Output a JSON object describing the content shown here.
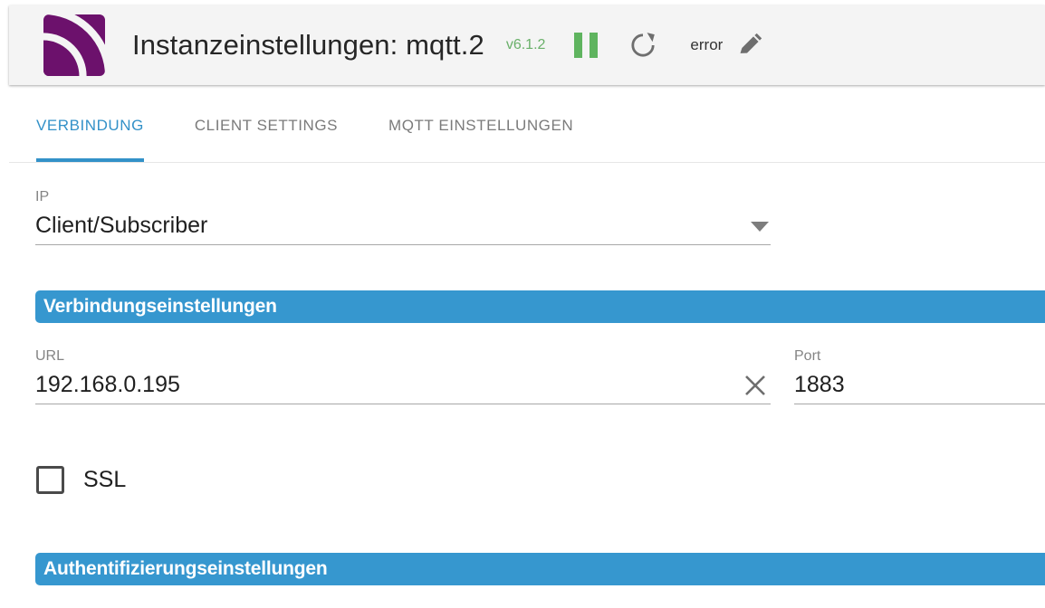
{
  "header": {
    "icon": "mqtt-signal-icon",
    "title": "Instanzeinstellungen: mqtt.2",
    "version": "v6.1.2",
    "pause_icon": "pause-icon",
    "refresh_icon": "refresh-icon",
    "status": "error",
    "edit_icon": "pencil-icon",
    "brand_color": "#6c116c",
    "version_color": "#6ab06a",
    "pause_color": "#5fb45f",
    "card_bg": "#f4f4f4"
  },
  "tabs": [
    {
      "label": "VERBINDUNG",
      "active": true
    },
    {
      "label": "CLIENT SETTINGS",
      "active": false
    },
    {
      "label": "MQTT EINSTELLUNGEN",
      "active": false
    }
  ],
  "tab_accent_color": "#3391c8",
  "form": {
    "ip": {
      "label": "IP",
      "value": "Client/Subscriber",
      "caret_icon": "chevron-down-icon"
    },
    "section_connection": "Verbindungseinstellungen",
    "url": {
      "label": "URL",
      "value": "192.168.0.195",
      "clear_icon": "close-icon"
    },
    "port": {
      "label": "Port",
      "value": "1883"
    },
    "ssl": {
      "label": "SSL",
      "checked": false
    },
    "section_auth": "Authentifizierungseinstellungen",
    "section_color": "#3697cf"
  }
}
